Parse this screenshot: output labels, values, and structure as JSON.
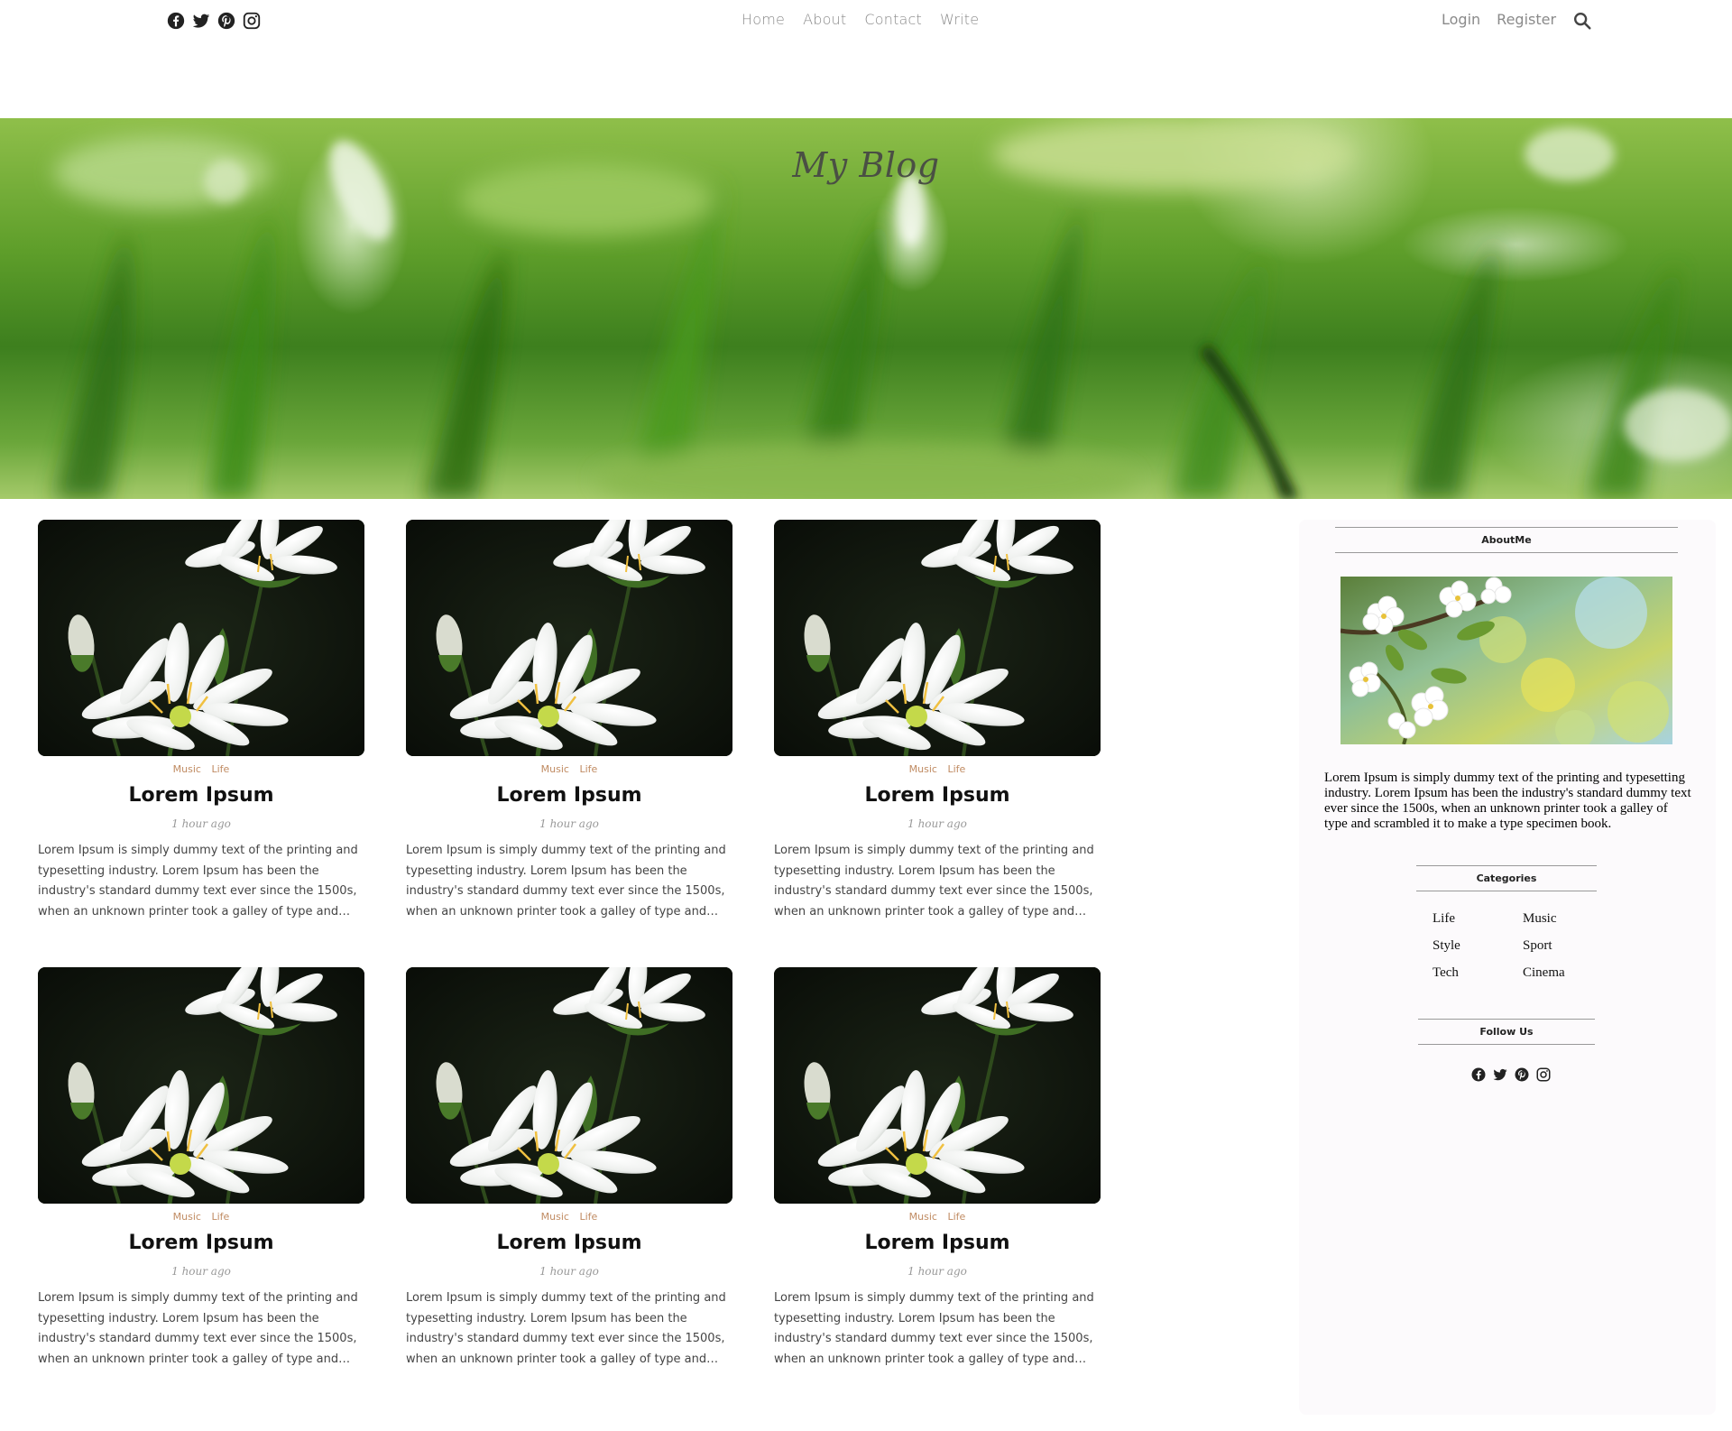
{
  "top_social": [
    {
      "name": "facebook-icon"
    },
    {
      "name": "twitter-icon"
    },
    {
      "name": "pinterest-icon"
    },
    {
      "name": "instagram-icon"
    }
  ],
  "nav": {
    "home": "Home",
    "about": "About",
    "contact": "Contact",
    "write": "Write",
    "login": "Login",
    "register": "Register",
    "search_icon": "search-icon"
  },
  "hero": {
    "title": "My Blog"
  },
  "posts": [
    {
      "cat1": "Music",
      "cat2": "Life",
      "title": "Lorem Ipsum",
      "date": "1 hour ago",
      "desc": "Lorem Ipsum is simply dummy text of the printing and typesetting industry. Lorem Ipsum has been the industry's standard dummy text ever since the 1500s, when an unknown printer took a galley of type and scrambled it to make a type specimen book."
    },
    {
      "cat1": "Music",
      "cat2": "Life",
      "title": "Lorem Ipsum",
      "date": "1 hour ago",
      "desc": "Lorem Ipsum is simply dummy text of the printing and typesetting industry. Lorem Ipsum has been the industry's standard dummy text ever since the 1500s, when an unknown printer took a galley of type and scrambled it to make a type specimen book."
    },
    {
      "cat1": "Music",
      "cat2": "Life",
      "title": "Lorem Ipsum",
      "date": "1 hour ago",
      "desc": "Lorem Ipsum is simply dummy text of the printing and typesetting industry. Lorem Ipsum has been the industry's standard dummy text ever since the 1500s, when an unknown printer took a galley of type and scrambled it to make a type specimen book."
    },
    {
      "cat1": "Music",
      "cat2": "Life",
      "title": "Lorem Ipsum",
      "date": "1 hour ago",
      "desc": "Lorem Ipsum is simply dummy text of the printing and typesetting industry. Lorem Ipsum has been the industry's standard dummy text ever since the 1500s, when an unknown printer took a galley of type and scrambled it to make a type specimen book."
    },
    {
      "cat1": "Music",
      "cat2": "Life",
      "title": "Lorem Ipsum",
      "date": "1 hour ago",
      "desc": "Lorem Ipsum is simply dummy text of the printing and typesetting industry. Lorem Ipsum has been the industry's standard dummy text ever since the 1500s, when an unknown printer took a galley of type and scrambled it to make a type specimen book."
    },
    {
      "cat1": "Music",
      "cat2": "Life",
      "title": "Lorem Ipsum",
      "date": "1 hour ago",
      "desc": "Lorem Ipsum is simply dummy text of the printing and typesetting industry. Lorem Ipsum has been the industry's standard dummy text ever since the 1500s, when an unknown printer took a galley of type and scrambled it to make a type specimen book."
    }
  ],
  "sidebar": {
    "about_heading": "AboutMe",
    "about_text": "Lorem Ipsum is simply dummy text of the printing and typesetting industry. Lorem Ipsum has been the industry's standard dummy text ever since the 1500s, when an unknown printer took a galley of type and scrambled it to make a type specimen book.",
    "categories_heading": "Categories",
    "categories": [
      "Life",
      "Music",
      "Style",
      "Sport",
      "Tech",
      "Cinema"
    ],
    "follow_heading": "Follow Us"
  },
  "colors": {
    "category_accent": "#c08b62",
    "nav_text": "#8a8a8a",
    "sidebar_bg": "#fcfafc"
  }
}
